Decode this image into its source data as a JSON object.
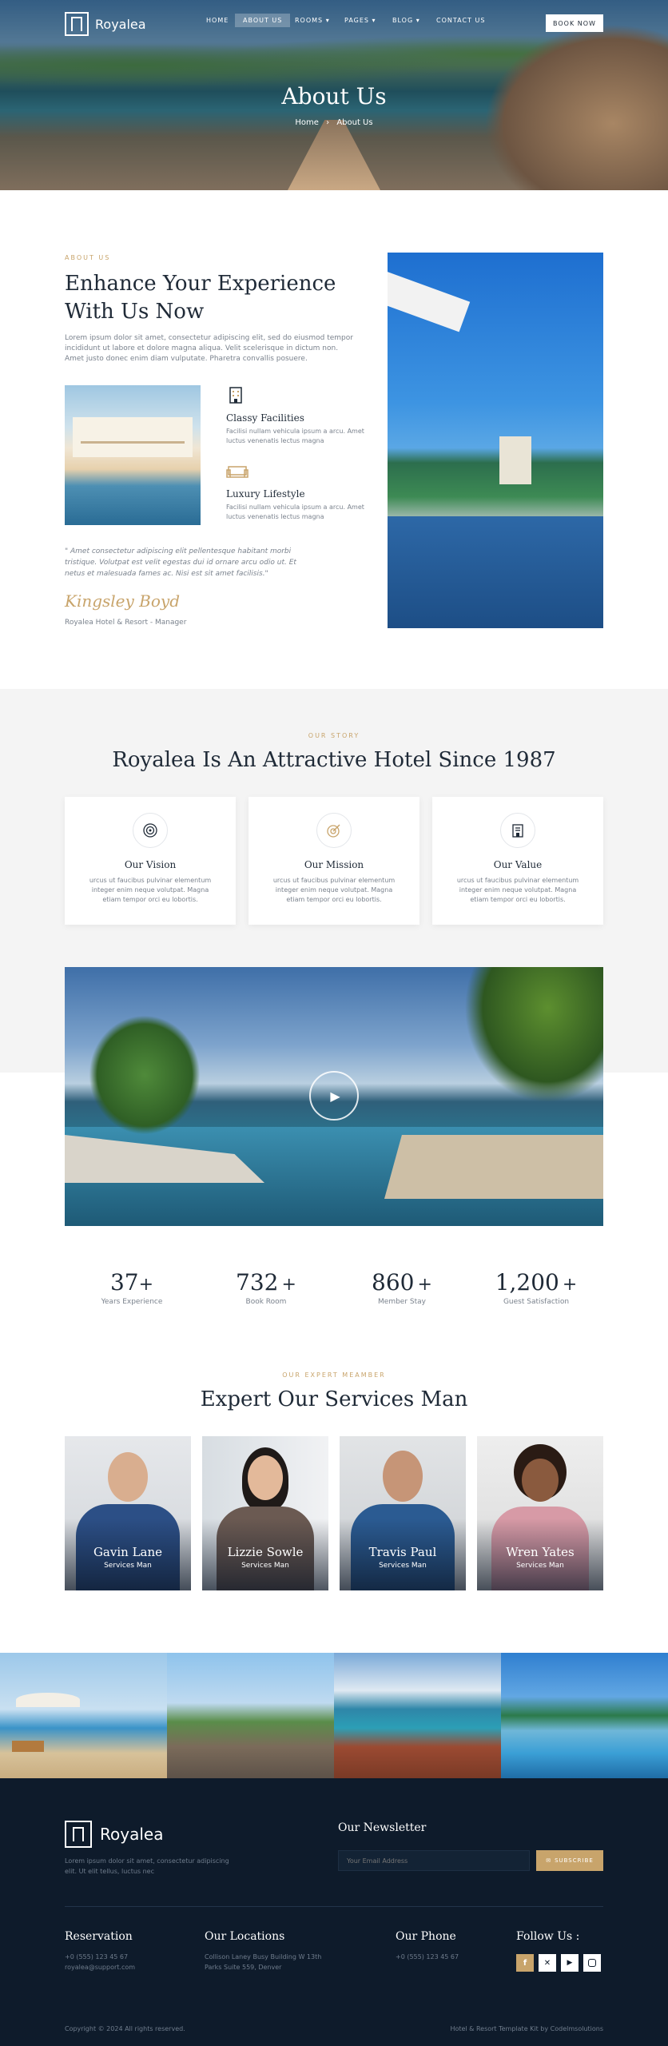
{
  "brand": {
    "name": "Royalea"
  },
  "nav": {
    "items": [
      "HOME",
      "ABOUT US",
      "ROOMS",
      "PAGES",
      "BLOG",
      "CONTACT US"
    ],
    "book_label": "BOOK NOW"
  },
  "hero": {
    "title": "About Us",
    "crumb_home": "Home",
    "crumb_sep": "›",
    "crumb_current": "About Us"
  },
  "about": {
    "eyebrow": "ABOUT US",
    "title_1": "Enhance Your Experience",
    "title_2": "With Us Now",
    "text": "Lorem ipsum dolor sit amet, consectetur adipiscing elit, sed do eiusmod tempor incididunt ut labore et dolore magna aliqua. Velit scelerisque in dictum non. Amet justo donec enim diam vulputate. Pharetra convallis posuere.",
    "features": [
      {
        "title": "Classy Facilities",
        "text": "Facilisi nullam vehicula ipsum a arcu. Amet luctus venenatis lectus magna",
        "icon": "building-icon"
      },
      {
        "title": "Luxury Lifestyle",
        "text": "Facilisi nullam vehicula ipsum a arcu. Amet luctus venenatis lectus magna",
        "icon": "sofa-icon"
      }
    ],
    "quote": "\" Amet consectetur adipiscing elit pellentesque habitant morbi tristique. Volutpat est velit egestas dui id ornare arcu odio ut. Et netus et malesuada fames ac. Nisi est sit amet facilisis.\"",
    "signature": "Kingsley Boyd",
    "author": "Royalea Hotel & Resort - Manager"
  },
  "story": {
    "eyebrow": "OUR STORY",
    "title": "Royalea Is An Attractive Hotel Since 1987",
    "cards": [
      {
        "title": "Our Vision",
        "text": "urcus ut faucibus pulvinar elementum integer enim neque volutpat. Magna etiam tempor orci eu lobortis.",
        "icon": "target-icon"
      },
      {
        "title": "Our Mission",
        "text": "urcus ut faucibus pulvinar elementum integer enim neque volutpat. Magna etiam tempor orci eu lobortis.",
        "icon": "dart-icon"
      },
      {
        "title": "Our Value",
        "text": "urcus ut faucibus pulvinar elementum integer enim neque volutpat. Magna etiam tempor orci eu lobortis.",
        "icon": "hotel-icon"
      }
    ]
  },
  "stats": [
    {
      "num": "37",
      "plus": "+",
      "label": "Years Experience"
    },
    {
      "num": "732",
      "plus": "+",
      "label": "Book Room"
    },
    {
      "num": "860",
      "plus": "+",
      "label": "Member Stay"
    },
    {
      "num": "1,200",
      "plus": "+",
      "label": "Guest Satisfaction"
    }
  ],
  "team": {
    "eyebrow": "OUR EXPERT MEAMBER",
    "title": "Expert Our Services Man",
    "members": [
      {
        "name": "Gavin Lane",
        "role": "Services Man"
      },
      {
        "name": "Lizzie Sowle",
        "role": "Services Man"
      },
      {
        "name": "Travis Paul",
        "role": "Services Man"
      },
      {
        "name": "Wren Yates",
        "role": "Services Man"
      }
    ]
  },
  "footer": {
    "tagline": "Lorem ipsum dolor sit amet, consectetur adipiscing elit. Ut elit tellus, luctus nec",
    "newsletter_title": "Our Newsletter",
    "email_placeholder": "Your Email Address",
    "subscribe_label": "SUBSCRIBE",
    "reservation_title": "Reservation",
    "reservation_phone": "+0 (555) 123 45 67",
    "reservation_email": "royalea@support.com",
    "locations_title": "Our Locations",
    "locations_line1": "Collison Laney Busy Building W 13th",
    "locations_line2": "Parks Suite 559, Denver",
    "phone_title": "Our Phone",
    "phone_value": "+0 (555) 123 45 67",
    "follow_title": "Follow Us :",
    "copyright": "Copyright © 2024 All rights reserved.",
    "credit": "Hotel & Resort Template Kit by Codelmsolutions"
  },
  "colors": {
    "accent": "#c8a46b",
    "dark": "#0e1b2b",
    "light_bg": "#f4f4f4"
  }
}
